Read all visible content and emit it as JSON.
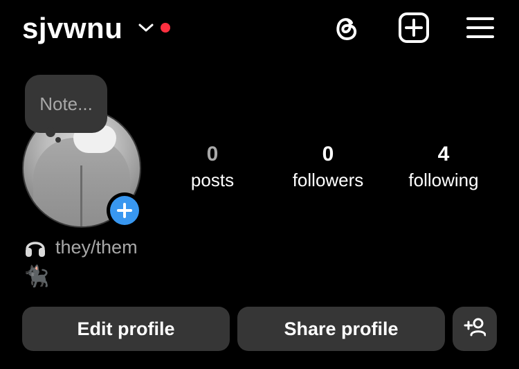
{
  "header": {
    "username": "sjvwnu",
    "notification_color": "#ff3040",
    "icons": [
      "chevron-down-icon",
      "threads-icon",
      "add-post-icon",
      "menu-icon"
    ]
  },
  "note": {
    "placeholder": "Note..."
  },
  "stats": [
    {
      "value": "0",
      "label": "posts"
    },
    {
      "value": "0",
      "label": "followers"
    },
    {
      "value": "4",
      "label": "following"
    }
  ],
  "bio": {
    "pronouns": "they/them",
    "emoji": "🐈‍⬛"
  },
  "buttons": {
    "edit_profile": "Edit profile",
    "share_profile": "Share profile"
  },
  "colors": {
    "background": "#000000",
    "button_bg": "#363636",
    "accent_blue": "#3897f0"
  }
}
